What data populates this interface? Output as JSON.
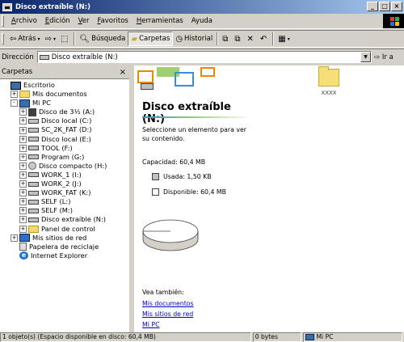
{
  "window": {
    "title": "Disco extraíble (N:)"
  },
  "menu": [
    {
      "u": "A",
      "rest": "rchivo"
    },
    {
      "u": "E",
      "rest": "dición"
    },
    {
      "u": "V",
      "rest": "er"
    },
    {
      "u": "F",
      "rest": "avoritos"
    },
    {
      "u": "H",
      "rest": "erramientas"
    },
    {
      "u": "",
      "rest": "Ayuda"
    }
  ],
  "toolbar": {
    "back": "Atrás",
    "search": "Búsqueda",
    "folders": "Carpetas",
    "history": "Historial"
  },
  "address": {
    "label": "Dirección",
    "value": "Disco extraíble (N:)",
    "go": "Ir a"
  },
  "folders_pane": {
    "title": "Carpetas",
    "close": "×"
  },
  "tree": [
    {
      "label": "Escritorio",
      "indent": 0,
      "exp": "",
      "icon": "desktop-icon",
      "cls": "ic-desk"
    },
    {
      "label": "Mis documentos",
      "indent": 1,
      "exp": "+",
      "icon": "folder-icon",
      "cls": "ic-folder"
    },
    {
      "label": "Mi PC",
      "indent": 1,
      "exp": "-",
      "icon": "computer-icon",
      "cls": "ic-pc"
    },
    {
      "label": "Disco de 3½ (A:)",
      "indent": 2,
      "exp": "+",
      "icon": "floppy-icon",
      "cls": "ic-floppy"
    },
    {
      "label": "Disco local (C:)",
      "indent": 2,
      "exp": "+",
      "icon": "drive-icon",
      "cls": "ic-drive"
    },
    {
      "label": "SC_2K_FAT (D:)",
      "indent": 2,
      "exp": "+",
      "icon": "drive-icon",
      "cls": "ic-drive"
    },
    {
      "label": "Disco local (E:)",
      "indent": 2,
      "exp": "+",
      "icon": "drive-icon",
      "cls": "ic-drive"
    },
    {
      "label": "TOOL (F:)",
      "indent": 2,
      "exp": "+",
      "icon": "drive-icon",
      "cls": "ic-drive"
    },
    {
      "label": "Program (G:)",
      "indent": 2,
      "exp": "+",
      "icon": "drive-icon",
      "cls": "ic-drive"
    },
    {
      "label": "Disco compacto (H:)",
      "indent": 2,
      "exp": "+",
      "icon": "cd-drive-icon",
      "cls": "ic-cd"
    },
    {
      "label": "WORK_1 (I:)",
      "indent": 2,
      "exp": "+",
      "icon": "drive-icon",
      "cls": "ic-drive"
    },
    {
      "label": "WORK_2 (J:)",
      "indent": 2,
      "exp": "+",
      "icon": "drive-icon",
      "cls": "ic-drive"
    },
    {
      "label": "WORK_FAT (K:)",
      "indent": 2,
      "exp": "+",
      "icon": "drive-icon",
      "cls": "ic-drive"
    },
    {
      "label": "SELF (L:)",
      "indent": 2,
      "exp": "+",
      "icon": "drive-icon",
      "cls": "ic-drive"
    },
    {
      "label": "SELF (M:)",
      "indent": 2,
      "exp": "+",
      "icon": "drive-icon",
      "cls": "ic-drive"
    },
    {
      "label": "Disco extraíble (N:)",
      "indent": 2,
      "exp": "+",
      "icon": "removable-drive-icon",
      "cls": "ic-drive"
    },
    {
      "label": "Panel de control",
      "indent": 2,
      "exp": "+",
      "icon": "control-panel-icon",
      "cls": "ic-folder"
    },
    {
      "label": "Mis sitios de red",
      "indent": 1,
      "exp": "+",
      "icon": "network-icon",
      "cls": "ic-net"
    },
    {
      "label": "Papelera de reciclaje",
      "indent": 1,
      "exp": "",
      "icon": "recycle-bin-icon",
      "cls": "ic-trash"
    },
    {
      "label": "Internet Explorer",
      "indent": 1,
      "exp": "",
      "icon": "internet-explorer-icon",
      "cls": "ic-ie"
    }
  ],
  "webview": {
    "title": "Disco extraíble (N:)",
    "prompt": "Seleccione un elemento para ver su contenido.",
    "capacity": "Capacidad: 60,4 MB",
    "used": "Usada: 1,50 KB",
    "free": "Disponible: 60,4 MB",
    "used_fraction": 2.4e-05,
    "see_also": "Vea también:",
    "links": [
      "Mis documentos",
      "Mis sitios de red",
      "Mi PC"
    ],
    "colors": {
      "used": "#c0c0c0",
      "free": "#ffffff"
    }
  },
  "files": [
    {
      "name": "XXXX",
      "icon": "folder-icon"
    }
  ],
  "status": {
    "objects": "1 objeto(s) (Espacio disponible en disco: 60,4 MB)",
    "size": "0 bytes",
    "zone": "Mi PC"
  }
}
